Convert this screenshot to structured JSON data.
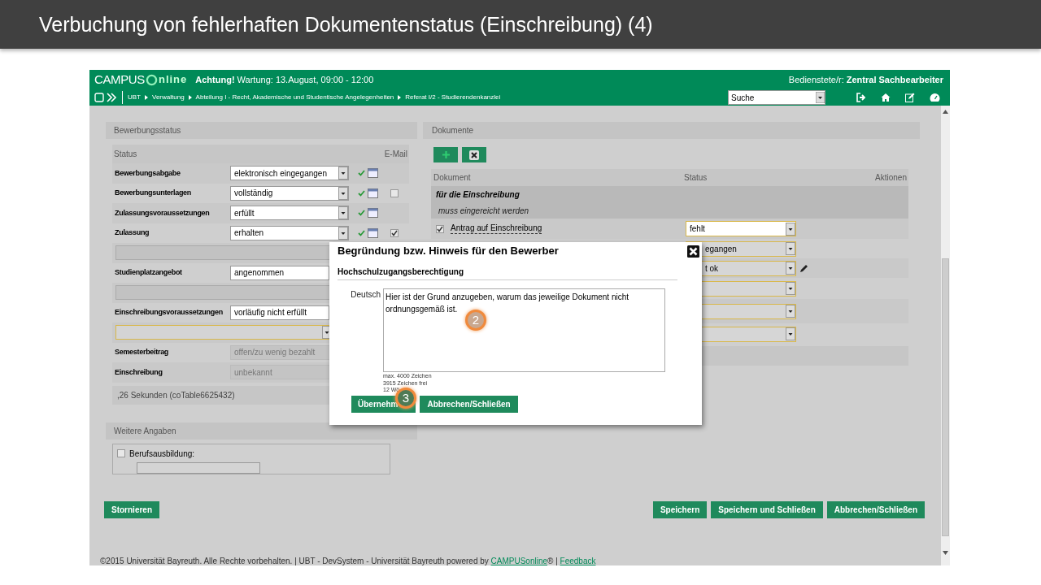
{
  "slide_title": "Verbuchung von fehlerhaften Dokumentenstatus (Einschreibung) (4)",
  "app": {
    "logo": {
      "left": "CAMPUS",
      "right": "nline"
    },
    "notice": "**Achtung!** Wartung: 13.August, 09:00 - 12:00",
    "user": "Bedienstete/r: **Zentral Sachbearbeiter**",
    "breadcrumb": [
      "UBT",
      "Verwaltung",
      "Abteilung I - Recht, Akademische und Studentische Angelegenheiten",
      "Referat I/2 - Studierendenkanzlei"
    ],
    "search_select": "Suche"
  },
  "status_section": {
    "title": "Bewerbungsstatus",
    "columns": [
      "Status",
      "E-Mail"
    ],
    "rows": [
      {
        "kind": "select",
        "label": "Bewerbungsabgabe",
        "value": "elektronisch eingegangen"
      },
      {
        "kind": "select",
        "label": "Bewerbungsunterlagen",
        "value": "vollständig",
        "email_checked": false
      },
      {
        "kind": "select",
        "label": "Zulassungsvoraussetzungen",
        "value": "erfüllt"
      },
      {
        "kind": "select",
        "label": "Zulassung",
        "value": "erhalten",
        "email_checked": true
      },
      {
        "kind": "blank_select"
      },
      {
        "kind": "select",
        "label": "Studienplatzangebot",
        "value": "angenommen",
        "covered": true
      },
      {
        "kind": "blank_select"
      },
      {
        "kind": "select",
        "label": "Einschreibungsvoraussetzungen",
        "value": "vorläufig nicht erfüllt",
        "covered": true
      },
      {
        "kind": "open_select"
      },
      {
        "kind": "readonly",
        "label": "Semesterbeitrag",
        "value": "offen/zu wenig bezahlt"
      },
      {
        "kind": "readonly",
        "label": "Einschreibung",
        "value": "unbekannt"
      }
    ],
    "footer": ",26 Sekunden (coTable6625432)"
  },
  "further_section": {
    "title": "Weitere Angaben",
    "fields": [
      {
        "label": "Berufsausbildung:",
        "checked": false
      }
    ]
  },
  "documents": {
    "title": "Dokumente",
    "columns": [
      "Dokument",
      "Status",
      "Aktionen"
    ],
    "group": {
      "title": "für die Einschreibung",
      "subtitle": "muss eingereicht werden"
    },
    "rows": [
      {
        "kind": "document",
        "name": "Antrag auf Einschreibung",
        "checked": true,
        "status": "fehlt"
      },
      {
        "kind": "partial",
        "status": "egangen"
      },
      {
        "kind": "partial",
        "status": "t ok",
        "editable": true
      },
      {
        "kind": "blank"
      },
      {
        "kind": "blank"
      },
      {
        "kind": "blank"
      }
    ]
  },
  "buttons_left": [
    "Stornieren"
  ],
  "buttons_right": [
    "Speichern",
    "Speichern und Schließen",
    "Abbrechen/Schließen"
  ],
  "footer": [
    {
      "kind": "text",
      "text": "©2015 Universität Bayreuth. Alle Rechte vorbehalten. | UBT - DevSystem - Universität Bayreuth powered by "
    },
    {
      "kind": "link",
      "text": "CAMPUSonline"
    },
    {
      "kind": "text",
      "text": "® | "
    },
    {
      "kind": "link",
      "text": "Feedback"
    }
  ],
  "dialog": {
    "title": "Begründung bzw. Hinweis für den Bewerber",
    "section": "Hochschulzugangsberechtigung",
    "field_label": "Deutsch",
    "value": "Hier ist der Grund anzugeben, warum das jeweilige Dokument nicht ordnungsgemäß ist.",
    "counters": [
      "max. 4000 Zeichen",
      "3915 Zeichen frei",
      "12 Wö"
    ],
    "buttons": [
      "Übernehm",
      "Abbrechen/Schließen"
    ]
  },
  "callouts": [
    "2",
    "3"
  ]
}
